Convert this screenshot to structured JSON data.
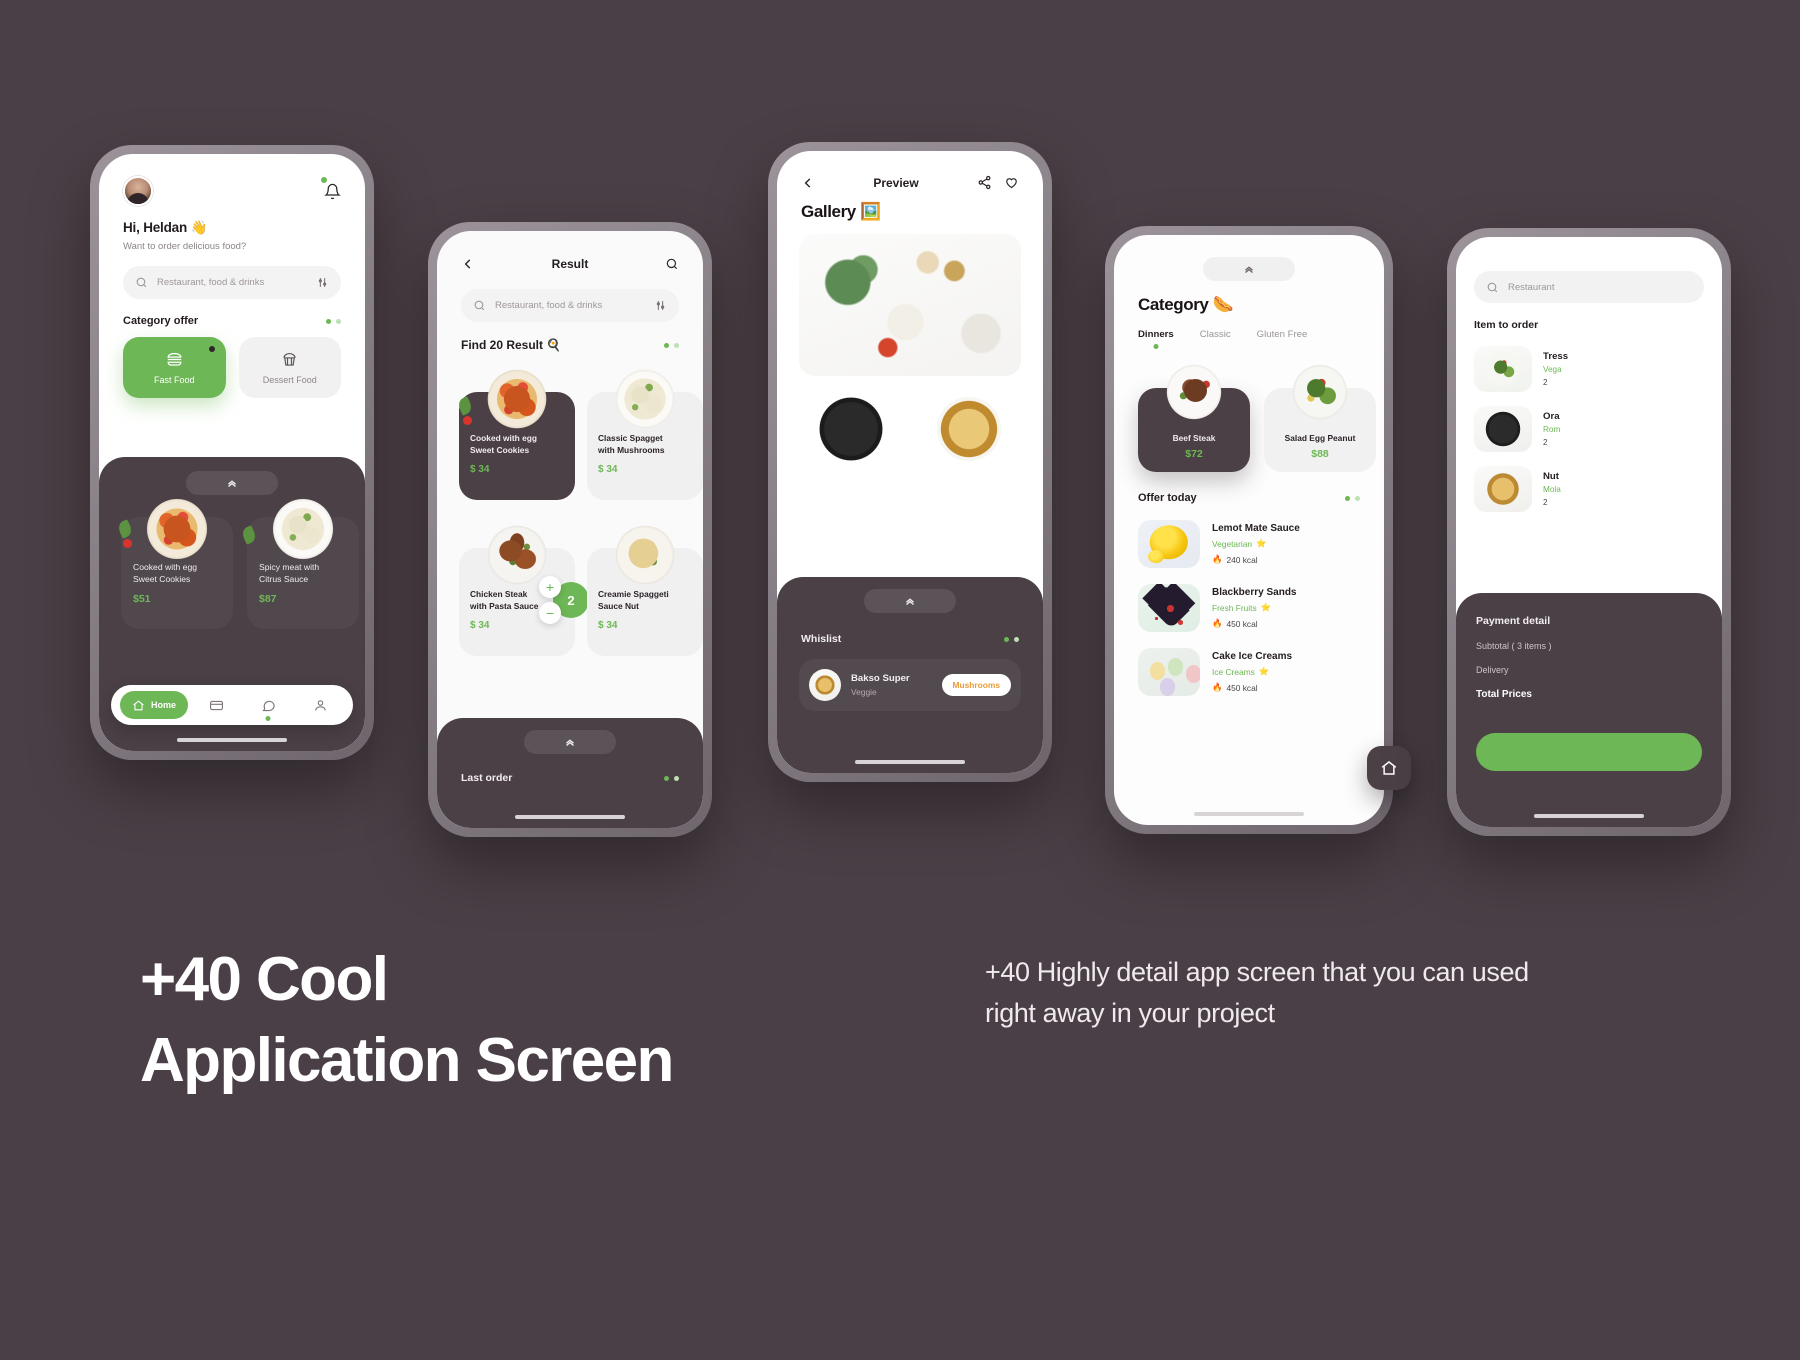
{
  "marketing": {
    "headline_line1": "+40 Cool",
    "headline_line2": "Application Screen",
    "body": "+40 Highly detail app screen that you can used right away in your project"
  },
  "colors": {
    "background": "#4a3f46",
    "accent_green": "#6db756",
    "dark_panel": "#4a4046",
    "orange_tag": "#e89b3c"
  },
  "phone1_home": {
    "greeting": "Hi, Heldan 👋",
    "subtitle": "Want to order delicious food?",
    "search_placeholder": "Restaurant, food & drinks",
    "section_title": "Category offer",
    "categories": [
      {
        "label": "Fast Food",
        "icon": "burger-icon",
        "active": true
      },
      {
        "label": "Dessert Food",
        "icon": "cupcake-icon",
        "active": false
      }
    ],
    "foods": [
      {
        "name_line1": "Cooked with egg",
        "name_line2": "Sweet Cookies",
        "price": "$51"
      },
      {
        "name_line1": "Spicy meat with",
        "name_line2": "Citrus Sauce",
        "price": "$87"
      }
    ],
    "nav": [
      {
        "label": "Home",
        "icon": "home-icon",
        "active": true
      },
      {
        "label": "",
        "icon": "card-icon",
        "active": false
      },
      {
        "label": "",
        "icon": "chat-icon",
        "active": false
      },
      {
        "label": "",
        "icon": "person-icon",
        "active": false
      }
    ]
  },
  "phone2_result": {
    "title": "Result",
    "search_placeholder": "Restaurant, food & drinks",
    "find_label": "Find 20 Result 🍳",
    "results": [
      {
        "name_line1": "Cooked with egg",
        "name_line2": "Sweet Cookies",
        "price": "$ 34",
        "theme": "dark"
      },
      {
        "name_line1": "Classic Spagget",
        "name_line2": "with Mushrooms",
        "price": "$ 34",
        "theme": "light"
      },
      {
        "name_line1": "Chicken Steak",
        "name_line2": "with Pasta Sauce",
        "price": "$ 34",
        "theme": "light"
      },
      {
        "name_line1": "Creamie Spaggeti",
        "name_line2": "Sauce Nut",
        "price": "$ 34",
        "theme": "light"
      }
    ],
    "stepper": {
      "plus": "+",
      "minus": "−",
      "count": "2"
    },
    "last_order_title": "Last order"
  },
  "phone3_preview": {
    "header_title": "Preview",
    "gallery_title": "Gallery 🖼️",
    "whishlist_title": "Whislist",
    "whishlist_item": {
      "name": "Bakso Super",
      "subtitle": "Veggie",
      "tag": "Mushrooms"
    },
    "icons": {
      "back": "back-arrow-icon",
      "share": "share-icon",
      "heart": "heart-icon"
    }
  },
  "phone4_category": {
    "title": "Category 🌭",
    "tabs": [
      {
        "label": "Dinners",
        "active": true
      },
      {
        "label": "Classic",
        "active": false
      },
      {
        "label": "Gluten Free",
        "active": false
      }
    ],
    "dishes": [
      {
        "name": "Beef Steak",
        "price": "$72",
        "theme": "dark"
      },
      {
        "name": "Salad Egg Peanut",
        "price": "$88",
        "theme": "light"
      }
    ],
    "offer_title": "Offer today",
    "offers": [
      {
        "name": "Lemot Mate Sauce",
        "tag": "Vegetarian",
        "star": "⭐",
        "kcal": "240 kcal",
        "flame": "🔥"
      },
      {
        "name": "Blackberry Sands",
        "tag": "Fresh Fruits",
        "star": "⭐",
        "kcal": "450 kcal",
        "flame": "🔥"
      },
      {
        "name": "Cake Ice Creams",
        "tag": "Ice Creams",
        "star": "⭐",
        "kcal": "450 kcal",
        "flame": "🔥"
      }
    ],
    "fab_icon": "home-icon"
  },
  "phone5_order": {
    "search_placeholder": "Restaurant",
    "list_title": "Item to order",
    "items": [
      {
        "name": "Tress",
        "tag": "Vega",
        "kcal": "2"
      },
      {
        "name": "Ora",
        "tag": "Rom",
        "kcal": "2"
      },
      {
        "name": "Nut",
        "tag": "Mola",
        "kcal": "2"
      }
    ],
    "payment": {
      "title": "Payment detail",
      "subtotal_label": "Subtotal ( 3 items )",
      "delivery_label": "Delivery",
      "total_label": "Total Prices"
    }
  }
}
